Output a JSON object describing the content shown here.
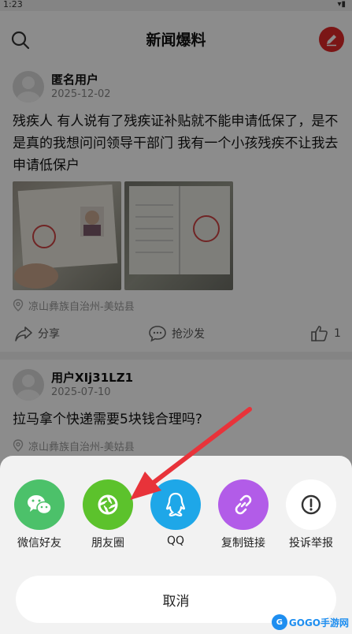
{
  "status_bar": {
    "time": "1:23"
  },
  "header": {
    "title": "新闻爆料"
  },
  "posts": [
    {
      "username": "匿名用户",
      "date": "2025-12-02",
      "content": "残疾人  有人说有了残疾证补贴就不能申请低保了，是不是真的我想问问领导干部门  我有一个小孩残疾不让我去申请低保户",
      "location": "凉山彝族自治州-美姑县",
      "share_label": "分享",
      "comment_label": "抢沙发",
      "like_count": "1"
    },
    {
      "username": "用户XIj31LZ1",
      "date": "2025-07-10",
      "content": "拉马拿个快递需要5块钱合理吗?",
      "location": "凉山彝族自治州-美姑县"
    }
  ],
  "share_sheet": {
    "items": [
      {
        "label": "微信好友",
        "icon": "wechat-icon",
        "color": "#4cc16a"
      },
      {
        "label": "朋友圈",
        "icon": "moments-icon",
        "color": "#5cc22c"
      },
      {
        "label": "QQ",
        "icon": "qq-icon",
        "color": "#1ea7e8"
      },
      {
        "label": "复制链接",
        "icon": "link-icon",
        "color": "#b25ce8"
      },
      {
        "label": "投诉举报",
        "icon": "report-icon",
        "color": "#ffffff"
      }
    ],
    "cancel_label": "取消"
  },
  "watermark": {
    "text": "GOGO手游网"
  },
  "colors": {
    "accent": "#e02929",
    "arrow": "#e8333a"
  }
}
